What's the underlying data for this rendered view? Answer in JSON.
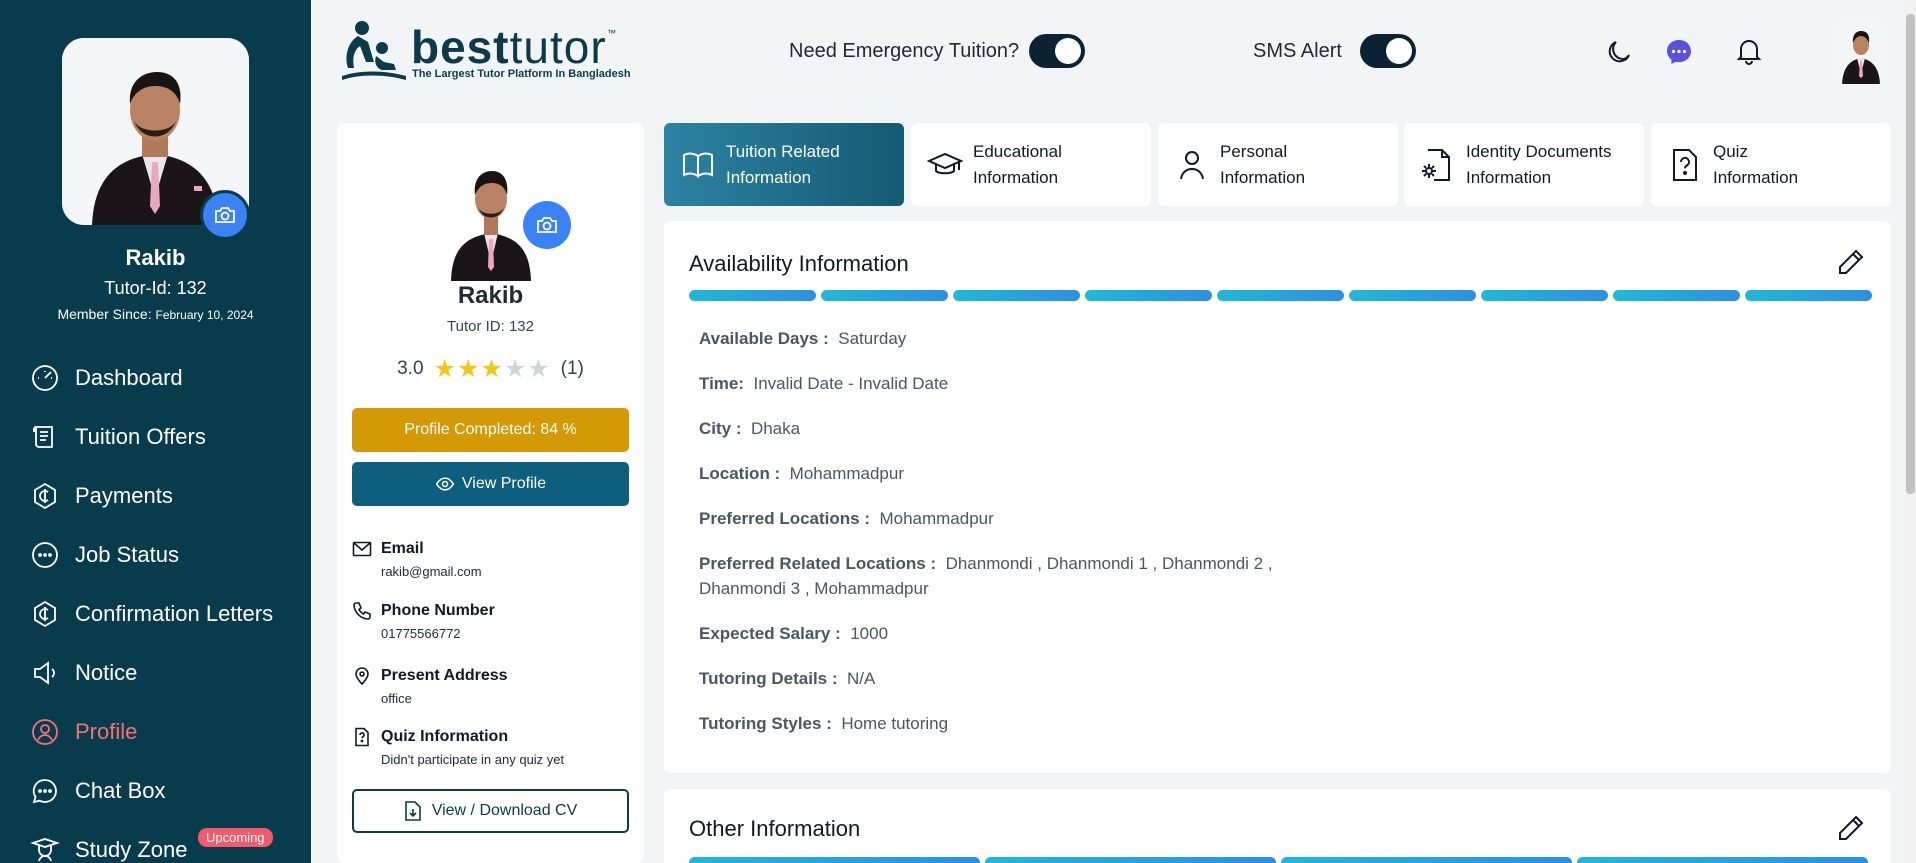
{
  "sidebar": {
    "name": "Rakib",
    "tutor_id": "Tutor-Id: 132",
    "member_since_label": "Member Since:",
    "member_since_date": "February 10, 2024",
    "nav": [
      {
        "label": "Dashboard",
        "icon": "gauge-icon"
      },
      {
        "label": "Tuition Offers",
        "icon": "scroll-icon"
      },
      {
        "label": "Payments",
        "icon": "coin-icon"
      },
      {
        "label": "Job Status",
        "icon": "dots-circle-icon"
      },
      {
        "label": "Confirmation Letters",
        "icon": "coin-icon"
      },
      {
        "label": "Notice",
        "icon": "megaphone-icon"
      },
      {
        "label": "Profile",
        "icon": "user-circle-icon",
        "active": true
      },
      {
        "label": "Chat Box",
        "icon": "chat-icon"
      },
      {
        "label": "Study Zone",
        "icon": "graduate-icon",
        "badge": "Upcoming"
      }
    ],
    "active_color": "#f87171",
    "bg_color": "#083c4c"
  },
  "header": {
    "logo_bold": "best",
    "logo_light": "tutor",
    "logo_tm": "™",
    "logo_tagline": "The Largest Tutor Platform In Bangladesh",
    "emergency_label": "Need Emergency Tuition?",
    "emergency_on": true,
    "sms_label": "SMS Alert",
    "sms_on": true,
    "icons": [
      "moon-icon",
      "messenger-icon",
      "bell-icon"
    ]
  },
  "profile_card": {
    "name": "Rakib",
    "tutor_id": "Tutor ID: 132",
    "rating": "3.0",
    "rating_value": 3,
    "rating_max": 5,
    "rating_count": "(1)",
    "profile_completed": "Profile Completed: 84 %",
    "view_profile": "View Profile",
    "email_label": "Email",
    "email": "rakib@gmail.com",
    "phone_label": "Phone Number",
    "phone": "01775566772",
    "address_label": "Present Address",
    "address": "office",
    "quiz_label": "Quiz Information",
    "quiz": "Didn't participate in any quiz yet",
    "cv_button": "View / Download CV"
  },
  "tabs": [
    {
      "line1": "Tuition Related",
      "line2": "Information",
      "icon": "book-icon",
      "active": true
    },
    {
      "line1": "Educational",
      "line2": "Information",
      "icon": "graduation-cap-icon"
    },
    {
      "line1": "Personal",
      "line2": "Information",
      "icon": "user-icon"
    },
    {
      "line1": "Identity Documents",
      "line2": "Information",
      "icon": "doc-gear-icon"
    },
    {
      "line1": "Quiz",
      "line2": "Information",
      "icon": "doc-question-icon"
    }
  ],
  "availability": {
    "title": "Availability Information",
    "segments": 9,
    "rows": [
      {
        "label": "Available Days :",
        "value": "Saturday"
      },
      {
        "label": "Time:",
        "value": "Invalid Date - Invalid Date"
      },
      {
        "label": "City :",
        "value": "Dhaka"
      },
      {
        "label": "Location :",
        "value": "Mohammadpur"
      },
      {
        "label": "Preferred Locations :",
        "value": "Mohammadpur"
      },
      {
        "label": "Preferred Related Locations :",
        "value": "Dhanmondi , Dhanmondi 1 , Dhanmondi 2 , Dhanmondi 3 , Mohammadpur"
      },
      {
        "label": "Expected Salary :",
        "value": "1000"
      },
      {
        "label": "Tutoring Details :",
        "value": "N/A"
      },
      {
        "label": "Tutoring Styles :",
        "value": "Home tutoring"
      }
    ]
  },
  "other": {
    "title": "Other Information",
    "segments": 4
  }
}
